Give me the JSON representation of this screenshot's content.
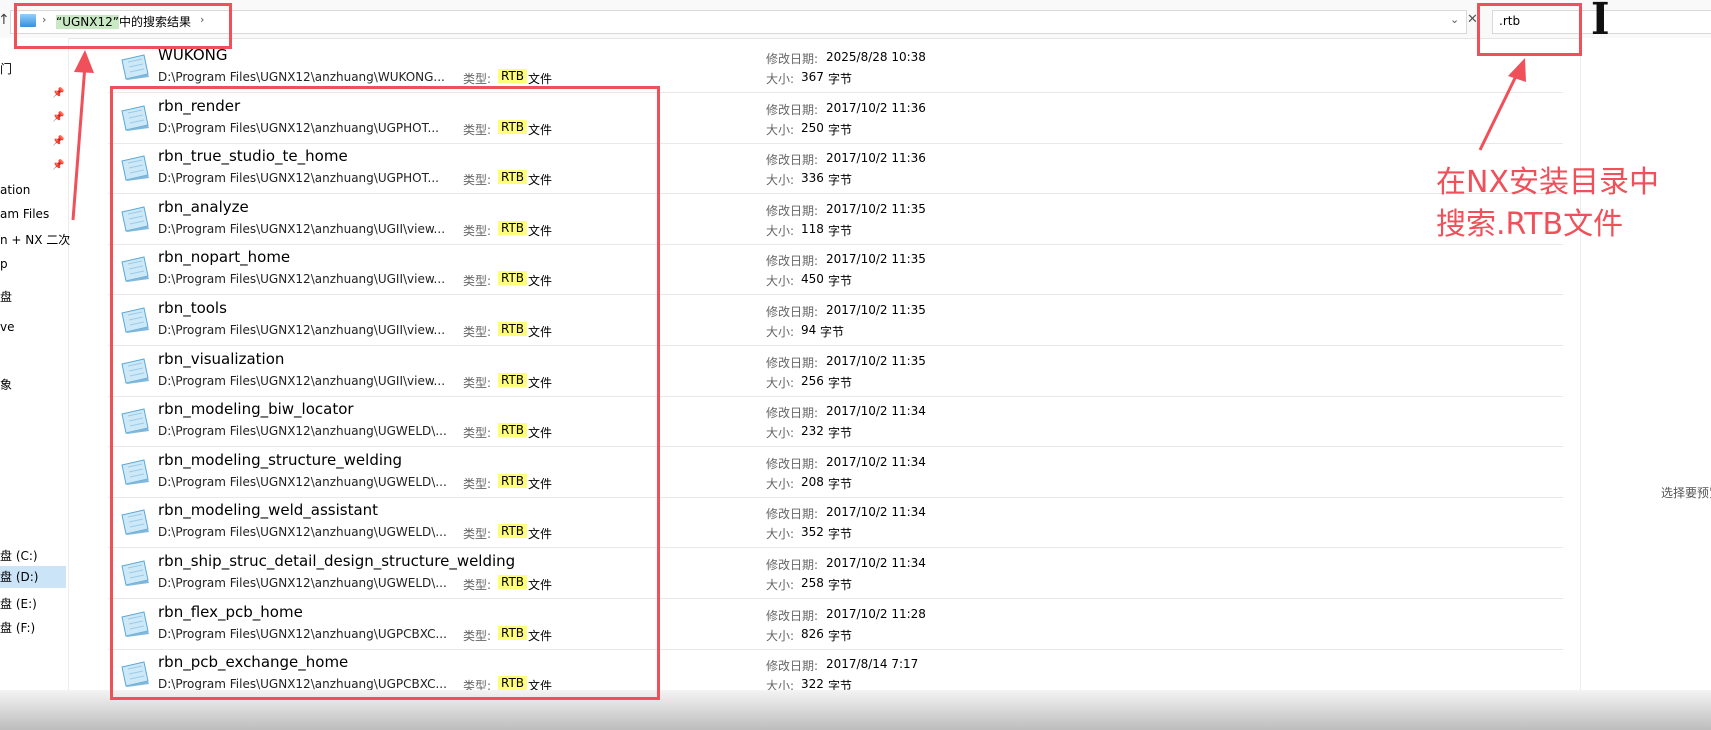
{
  "address_bar": {
    "breadcrumb_prefix": "“UGNX12”",
    "breadcrumb_suffix": "中的搜索结果",
    "search_value": ".rtb"
  },
  "sidebar": {
    "items": [
      "ation",
      "am Files",
      "n + NX 二次",
      "p",
      "盘",
      "ve",
      "象"
    ],
    "drives": [
      "盘 (C:)",
      "盘 (D:)",
      "盘 (E:)",
      "盘 (F:)"
    ]
  },
  "labels": {
    "type": "类型:",
    "type_value": "RTB",
    "type_suffix": "文件",
    "modified": "修改日期:",
    "size": "大小:",
    "size_unit": "字节"
  },
  "files": [
    {
      "name": "WUKONG",
      "path": "D:\\Program Files\\UGNX12\\anzhuang\\WUKONG...",
      "date": "2025/8/28 10:38",
      "size": "367"
    },
    {
      "name": "rbn_render",
      "path": "D:\\Program Files\\UGNX12\\anzhuang\\UGPHOT...",
      "date": "2017/10/2 11:36",
      "size": "250"
    },
    {
      "name": "rbn_true_studio_te_home",
      "path": "D:\\Program Files\\UGNX12\\anzhuang\\UGPHOT...",
      "date": "2017/10/2 11:36",
      "size": "336"
    },
    {
      "name": "rbn_analyze",
      "path": "D:\\Program Files\\UGNX12\\anzhuang\\UGII\\view...",
      "date": "2017/10/2 11:35",
      "size": "118"
    },
    {
      "name": "rbn_nopart_home",
      "path": "D:\\Program Files\\UGNX12\\anzhuang\\UGII\\view...",
      "date": "2017/10/2 11:35",
      "size": "450"
    },
    {
      "name": "rbn_tools",
      "path": "D:\\Program Files\\UGNX12\\anzhuang\\UGII\\view...",
      "date": "2017/10/2 11:35",
      "size": "94"
    },
    {
      "name": "rbn_visualization",
      "path": "D:\\Program Files\\UGNX12\\anzhuang\\UGII\\view...",
      "date": "2017/10/2 11:35",
      "size": "256"
    },
    {
      "name": "rbn_modeling_biw_locator",
      "path": "D:\\Program Files\\UGNX12\\anzhuang\\UGWELD\\...",
      "date": "2017/10/2 11:34",
      "size": "232"
    },
    {
      "name": "rbn_modeling_structure_welding",
      "path": "D:\\Program Files\\UGNX12\\anzhuang\\UGWELD\\...",
      "date": "2017/10/2 11:34",
      "size": "208"
    },
    {
      "name": "rbn_modeling_weld_assistant",
      "path": "D:\\Program Files\\UGNX12\\anzhuang\\UGWELD\\...",
      "date": "2017/10/2 11:34",
      "size": "352"
    },
    {
      "name": "rbn_ship_struc_detail_design_structure_welding",
      "path": "D:\\Program Files\\UGNX12\\anzhuang\\UGWELD\\...",
      "date": "2017/10/2 11:34",
      "size": "258"
    },
    {
      "name": "rbn_flex_pcb_home",
      "path": "D:\\Program Files\\UGNX12\\anzhuang\\UGPCBXC...",
      "date": "2017/10/2 11:28",
      "size": "826"
    },
    {
      "name": "rbn_pcb_exchange_home",
      "path": "D:\\Program Files\\UGNX12\\anzhuang\\UGPCBXC...",
      "date": "2017/8/14 7:17",
      "size": "322"
    }
  ],
  "preview": {
    "text": "选择要预览"
  },
  "annotation": {
    "line1": "在NX安装目录中",
    "line2": "搜索.RTB文件",
    "color": "#f0505a"
  }
}
